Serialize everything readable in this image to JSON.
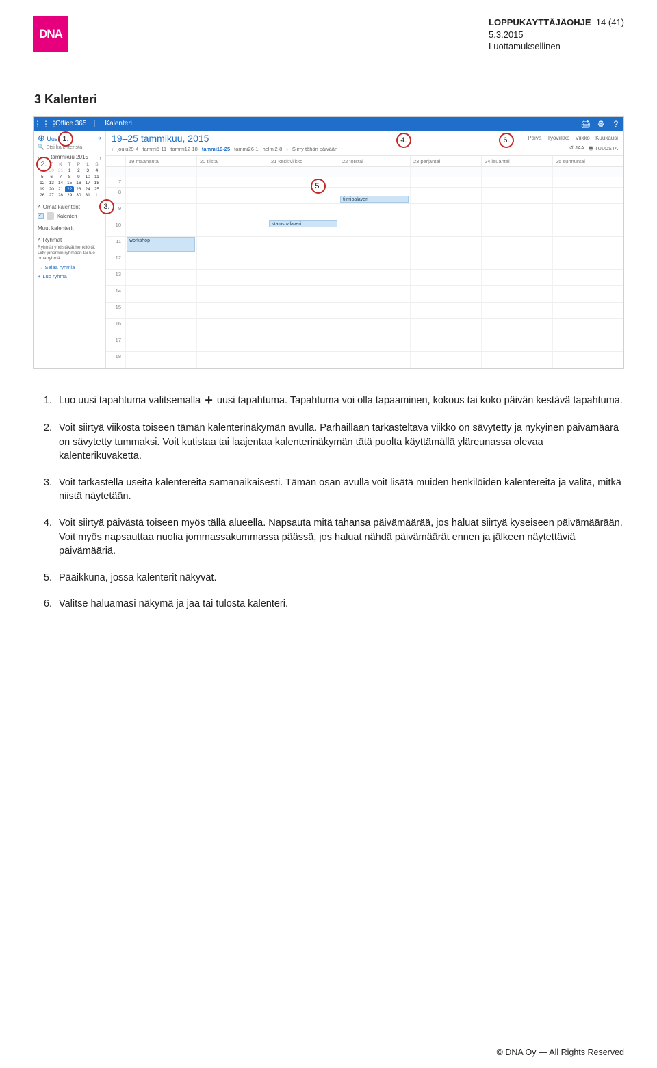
{
  "doc": {
    "title_line": "LOPPUKÄYTTÄJÄOHJE",
    "page_info": "14 (41)",
    "date": "5.3.2015",
    "classification": "Luottamuksellinen",
    "logo_text": "DNA"
  },
  "section": {
    "heading": "3  Kalenteri"
  },
  "shot": {
    "topbar": {
      "product": "Office 365",
      "breadcrumb": "Kalenteri",
      "icons": {
        "grid": "grid-icon",
        "print": "🖨",
        "gear": "⚙",
        "help": "?"
      }
    },
    "side": {
      "new_label": "Uusi",
      "search_placeholder": "Etsi kalenterista",
      "month_title": "tammikuu 2015",
      "own_cal_label": "Omat kalenterit",
      "cal_item": "Kalenteri",
      "other_cal_label": "Muut kalenterit",
      "groups_label": "Ryhmät",
      "groups_text": "Ryhmät yhdistävät henkilöitä. Liity johonkin ryhmään tai luo oma ryhmä.",
      "browse_groups": "Selaa ryhmiä",
      "create_group": "Luo ryhmä"
    },
    "main": {
      "range_title": "19–25 tammikuu, 2015",
      "views": [
        "Päivä",
        "Työviikko",
        "Viikko",
        "Kuukausi"
      ],
      "share": "JAA",
      "print": "TULOSTA",
      "weeks": [
        "joulu29-4",
        "tammi5-11",
        "tammi12-18",
        "tammi19-25",
        "tammi26-1",
        "helmi2-8"
      ],
      "go_today": "Siirry tähän päivään",
      "days": [
        "19 maanantai",
        "20 tiistai",
        "21 keskiviikko",
        "22 torstai",
        "23 perjantai",
        "24 lauantai",
        "25 sunnuntai"
      ],
      "hours": [
        "7",
        "8",
        "9",
        "10",
        "11",
        "12",
        "13",
        "14",
        "15",
        "16",
        "17",
        "18"
      ],
      "events": {
        "workshop": "workshop",
        "tiimipalaveri": "tiimipalaveri",
        "statuspalaveri": "statuspalaveri"
      }
    },
    "callouts": {
      "c1": "1.",
      "c2": "2.",
      "c3": "3.",
      "c4": "4.",
      "c5": "5.",
      "c6": "6."
    }
  },
  "list": {
    "i1a": "Luo uusi tapahtuma valitsemalla ",
    "i1b": " uusi tapahtuma. Tapahtuma voi olla tapaaminen, kokous tai koko päivän kestävä tapahtuma.",
    "i2": "Voit siirtyä viikosta toiseen tämän kalenterinäkymän avulla. Parhaillaan tarkasteltava viikko on sävytetty ja nykyinen päivämäärä on sävytetty tummaksi. Voit kutistaa tai laajentaa kalenterinäkymän tätä puolta käyttämällä yläreunassa olevaa kalenterikuvaketta.",
    "i3": "Voit tarkastella useita kalentereita samanaikaisesti. Tämän osan avulla voit lisätä muiden henkilöiden kalentereita ja valita, mitkä niistä näytetään.",
    "i4": "Voit siirtyä päivästä toiseen myös tällä alueella. Napsauta mitä tahansa päivämäärää, jos haluat siirtyä kyseiseen päivämäärään. Voit myös napsauttaa nuolia jommassakummassa päässä, jos haluat nähdä päivämäärät ennen ja jälkeen näytettäviä päivämääriä.",
    "i5": "Pääikkuna, jossa kalenterit näkyvät.",
    "i6": "Valitse haluamasi näkymä ja jaa tai tulosta kalenteri."
  },
  "footer": "© DNA Oy — All Rights Reserved"
}
